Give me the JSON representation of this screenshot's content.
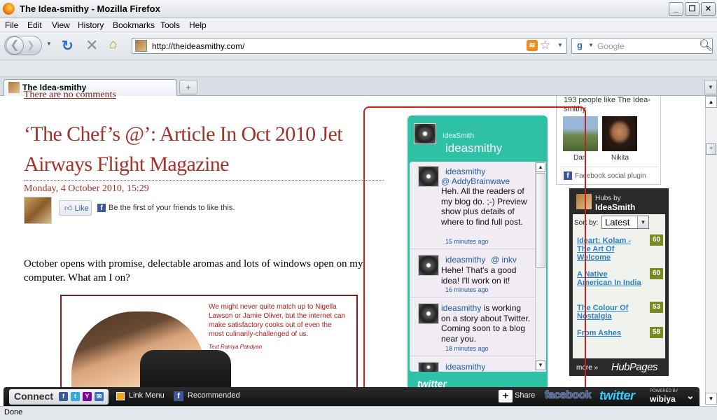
{
  "window": {
    "title": "The Idea-smithy - Mozilla Firefox"
  },
  "menu": [
    "File",
    "Edit",
    "View",
    "History",
    "Bookmarks",
    "Tools",
    "Help"
  ],
  "nav": {
    "url": "http://theideasmithy.com/",
    "search_placeholder": "Google"
  },
  "tab": {
    "title": "The Idea-smithy",
    "new_tab": "+",
    "list_icon": "▼"
  },
  "post": {
    "prev_link": "There are no comments",
    "title": "‘The Chef’s @’: Article In Oct 2010 Jet Airways Flight Magazine",
    "date": "Monday, 4 October 2010, 15:29",
    "like_label": "Like",
    "like_text": "Be the first of your friends to like this.",
    "paragraph": "October opens with promise, delectable aromas and lots of windows open on my computer. What am I on?",
    "image_quote": "We might never quite match up to Nigella Lawson or Jamie Oliver, but the internet can make satisfactory cooks out of even the most culinarily-challenged of us.",
    "image_credit": "Text Ramya Pandyan"
  },
  "twitter": {
    "label_small": "IdeaSmith",
    "handle": "ideasmithy",
    "logo": "twitter",
    "tweets": [
      {
        "user": "ideasmithy",
        "mention": "@ AddyBrainwave",
        "text": "Heh. All the readers of my blog do. ;-) Preview show plus details of where to find full post.",
        "time": "15 minutes ago"
      },
      {
        "user": "ideasmithy",
        "mention": "@ inkv",
        "text": "Hehe! That's a good idea! I'll work on it!",
        "time": "16 minutes ago"
      },
      {
        "user": "ideasmithy",
        "mention": "",
        "text": "is working on a story about Twitter. Coming soon to a blog near you.",
        "time": "18 minutes ago"
      },
      {
        "user": "ideasmithy",
        "mention": "",
        "text": "",
        "time": ""
      }
    ]
  },
  "facebook_box": {
    "count_text": "193 people like The Idea-smithy",
    "people": [
      "Dan",
      "Nikita"
    ],
    "plugin_text": "Facebook social plugin"
  },
  "hubpages": {
    "hubs_by": "Hubs by",
    "author": "IdeaSmith",
    "sort_label": "Sort by:",
    "sort_value": "Latest",
    "items": [
      {
        "title": "Ideart: Kolam - The Art Of Welcome",
        "score": "60"
      },
      {
        "title": "A Native American In India",
        "score": "60"
      },
      {
        "title": "The Colour Of Nostalgia",
        "score": "53"
      },
      {
        "title": "From Ashes",
        "score": "58"
      }
    ],
    "more": "more »",
    "logo": "HubPages"
  },
  "wibiya": {
    "connect": "Connect",
    "link_menu": "Link Menu",
    "recommended": "Recommended",
    "share": "Share",
    "facebook": "facebook",
    "twitter": "twitter",
    "powered": "POWERED BY",
    "brand": "wibiya"
  },
  "status": "Done"
}
